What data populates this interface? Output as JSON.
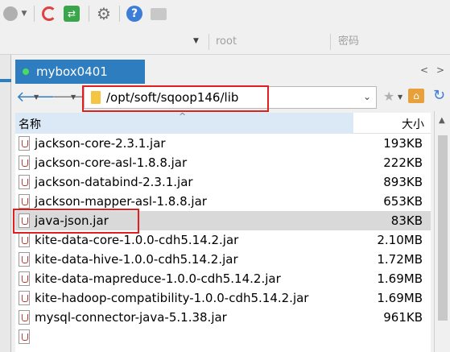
{
  "host": {
    "user": "root",
    "password_placeholder": "密码"
  },
  "tab": {
    "label": "mybox0401",
    "nav_left": "<",
    "nav_right": ">"
  },
  "address": {
    "path": "/opt/soft/sqoop146/lib"
  },
  "columns": {
    "name": "名称",
    "size": "大小"
  },
  "files": [
    {
      "name": "jackson-core-2.3.1.jar",
      "size": "193KB"
    },
    {
      "name": "jackson-core-asl-1.8.8.jar",
      "size": "222KB"
    },
    {
      "name": "jackson-databind-2.3.1.jar",
      "size": "893KB"
    },
    {
      "name": "jackson-mapper-asl-1.8.8.jar",
      "size": "653KB"
    },
    {
      "name": "java-json.jar",
      "size": "83KB"
    },
    {
      "name": "kite-data-core-1.0.0-cdh5.14.2.jar",
      "size": "2.10MB"
    },
    {
      "name": "kite-data-hive-1.0.0-cdh5.14.2.jar",
      "size": "1.72MB"
    },
    {
      "name": "kite-data-mapreduce-1.0.0-cdh5.14.2.jar",
      "size": "1.69MB"
    },
    {
      "name": "kite-hadoop-compatibility-1.0.0-cdh5.14.2.jar",
      "size": "1.69MB"
    },
    {
      "name": "mysql-connector-java-5.1.38.jar",
      "size": "961KB"
    }
  ],
  "selected_file": "java-json.jar",
  "colors": {
    "tab_bg": "#2e7dbf",
    "highlight_border": "#e02020",
    "selected_row": "#d9d9d9"
  }
}
